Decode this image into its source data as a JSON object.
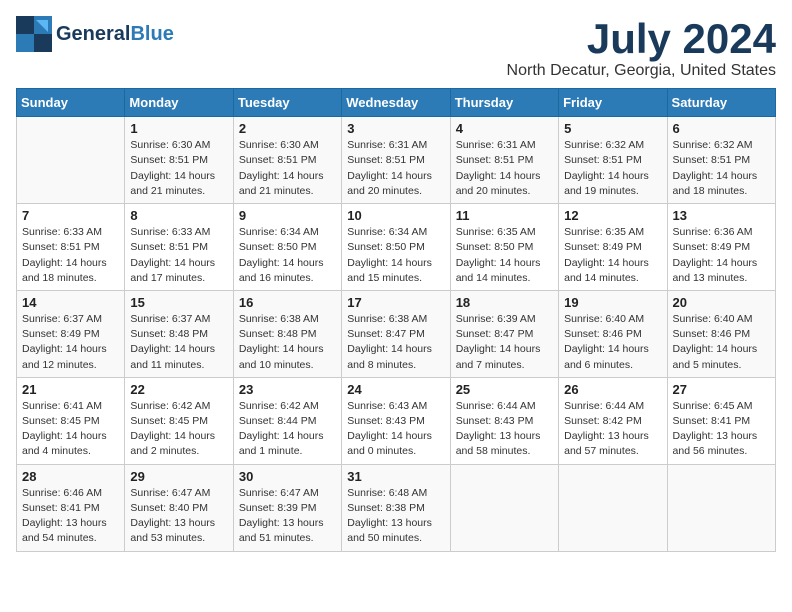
{
  "header": {
    "logo_line1": "General",
    "logo_line2": "Blue",
    "month_year": "July 2024",
    "location": "North Decatur, Georgia, United States"
  },
  "days_of_week": [
    "Sunday",
    "Monday",
    "Tuesday",
    "Wednesday",
    "Thursday",
    "Friday",
    "Saturday"
  ],
  "weeks": [
    [
      {
        "day": "",
        "info": ""
      },
      {
        "day": "1",
        "info": "Sunrise: 6:30 AM\nSunset: 8:51 PM\nDaylight: 14 hours\nand 21 minutes."
      },
      {
        "day": "2",
        "info": "Sunrise: 6:30 AM\nSunset: 8:51 PM\nDaylight: 14 hours\nand 21 minutes."
      },
      {
        "day": "3",
        "info": "Sunrise: 6:31 AM\nSunset: 8:51 PM\nDaylight: 14 hours\nand 20 minutes."
      },
      {
        "day": "4",
        "info": "Sunrise: 6:31 AM\nSunset: 8:51 PM\nDaylight: 14 hours\nand 20 minutes."
      },
      {
        "day": "5",
        "info": "Sunrise: 6:32 AM\nSunset: 8:51 PM\nDaylight: 14 hours\nand 19 minutes."
      },
      {
        "day": "6",
        "info": "Sunrise: 6:32 AM\nSunset: 8:51 PM\nDaylight: 14 hours\nand 18 minutes."
      }
    ],
    [
      {
        "day": "7",
        "info": "Sunrise: 6:33 AM\nSunset: 8:51 PM\nDaylight: 14 hours\nand 18 minutes."
      },
      {
        "day": "8",
        "info": "Sunrise: 6:33 AM\nSunset: 8:51 PM\nDaylight: 14 hours\nand 17 minutes."
      },
      {
        "day": "9",
        "info": "Sunrise: 6:34 AM\nSunset: 8:50 PM\nDaylight: 14 hours\nand 16 minutes."
      },
      {
        "day": "10",
        "info": "Sunrise: 6:34 AM\nSunset: 8:50 PM\nDaylight: 14 hours\nand 15 minutes."
      },
      {
        "day": "11",
        "info": "Sunrise: 6:35 AM\nSunset: 8:50 PM\nDaylight: 14 hours\nand 14 minutes."
      },
      {
        "day": "12",
        "info": "Sunrise: 6:35 AM\nSunset: 8:49 PM\nDaylight: 14 hours\nand 14 minutes."
      },
      {
        "day": "13",
        "info": "Sunrise: 6:36 AM\nSunset: 8:49 PM\nDaylight: 14 hours\nand 13 minutes."
      }
    ],
    [
      {
        "day": "14",
        "info": "Sunrise: 6:37 AM\nSunset: 8:49 PM\nDaylight: 14 hours\nand 12 minutes."
      },
      {
        "day": "15",
        "info": "Sunrise: 6:37 AM\nSunset: 8:48 PM\nDaylight: 14 hours\nand 11 minutes."
      },
      {
        "day": "16",
        "info": "Sunrise: 6:38 AM\nSunset: 8:48 PM\nDaylight: 14 hours\nand 10 minutes."
      },
      {
        "day": "17",
        "info": "Sunrise: 6:38 AM\nSunset: 8:47 PM\nDaylight: 14 hours\nand 8 minutes."
      },
      {
        "day": "18",
        "info": "Sunrise: 6:39 AM\nSunset: 8:47 PM\nDaylight: 14 hours\nand 7 minutes."
      },
      {
        "day": "19",
        "info": "Sunrise: 6:40 AM\nSunset: 8:46 PM\nDaylight: 14 hours\nand 6 minutes."
      },
      {
        "day": "20",
        "info": "Sunrise: 6:40 AM\nSunset: 8:46 PM\nDaylight: 14 hours\nand 5 minutes."
      }
    ],
    [
      {
        "day": "21",
        "info": "Sunrise: 6:41 AM\nSunset: 8:45 PM\nDaylight: 14 hours\nand 4 minutes."
      },
      {
        "day": "22",
        "info": "Sunrise: 6:42 AM\nSunset: 8:45 PM\nDaylight: 14 hours\nand 2 minutes."
      },
      {
        "day": "23",
        "info": "Sunrise: 6:42 AM\nSunset: 8:44 PM\nDaylight: 14 hours\nand 1 minute."
      },
      {
        "day": "24",
        "info": "Sunrise: 6:43 AM\nSunset: 8:43 PM\nDaylight: 14 hours\nand 0 minutes."
      },
      {
        "day": "25",
        "info": "Sunrise: 6:44 AM\nSunset: 8:43 PM\nDaylight: 13 hours\nand 58 minutes."
      },
      {
        "day": "26",
        "info": "Sunrise: 6:44 AM\nSunset: 8:42 PM\nDaylight: 13 hours\nand 57 minutes."
      },
      {
        "day": "27",
        "info": "Sunrise: 6:45 AM\nSunset: 8:41 PM\nDaylight: 13 hours\nand 56 minutes."
      }
    ],
    [
      {
        "day": "28",
        "info": "Sunrise: 6:46 AM\nSunset: 8:41 PM\nDaylight: 13 hours\nand 54 minutes."
      },
      {
        "day": "29",
        "info": "Sunrise: 6:47 AM\nSunset: 8:40 PM\nDaylight: 13 hours\nand 53 minutes."
      },
      {
        "day": "30",
        "info": "Sunrise: 6:47 AM\nSunset: 8:39 PM\nDaylight: 13 hours\nand 51 minutes."
      },
      {
        "day": "31",
        "info": "Sunrise: 6:48 AM\nSunset: 8:38 PM\nDaylight: 13 hours\nand 50 minutes."
      },
      {
        "day": "",
        "info": ""
      },
      {
        "day": "",
        "info": ""
      },
      {
        "day": "",
        "info": ""
      }
    ]
  ]
}
